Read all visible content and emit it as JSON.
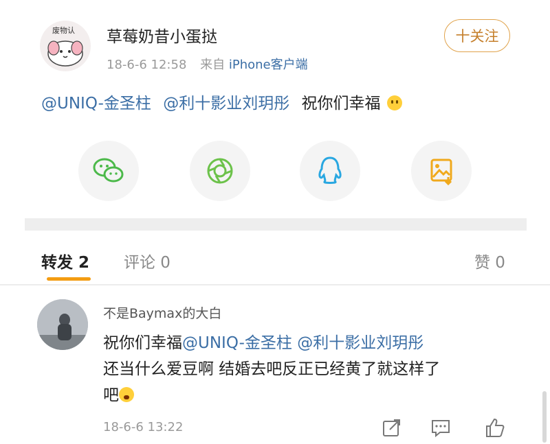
{
  "post": {
    "author": "草莓奶昔小蛋挞",
    "time": "18-6-6 12:58",
    "source_prefix": "来自",
    "source_client": "iPhone客户端",
    "follow_label": "十关注",
    "avatar_text": "废物认",
    "text": {
      "mention1": "@UNIQ-金圣柱",
      "mention2": "@利十影业刘玥彤",
      "message": "祝你们幸福"
    },
    "share_icons": [
      "wechat-icon",
      "moments-icon",
      "qq-icon",
      "save-image-icon"
    ]
  },
  "tabs": {
    "forward": "转发 2",
    "comment": "评论 0",
    "like": "赞 0"
  },
  "repost": {
    "username": "不是Baymax的大白",
    "line1_text": "祝你们幸福",
    "mention1": "@UNIQ-金圣柱",
    "mention2": "@利十影业刘玥彤",
    "line2": "还当什么爱豆啊 结婚去吧反正已经黄了就这样了",
    "line3": "吧",
    "time": "18-6-6 13:22",
    "action_icons": [
      "forward-icon",
      "comment-icon",
      "like-icon"
    ]
  },
  "colors": {
    "link": "#3b6ea5",
    "accent": "#f39c12",
    "follow": "#e0a24a"
  }
}
